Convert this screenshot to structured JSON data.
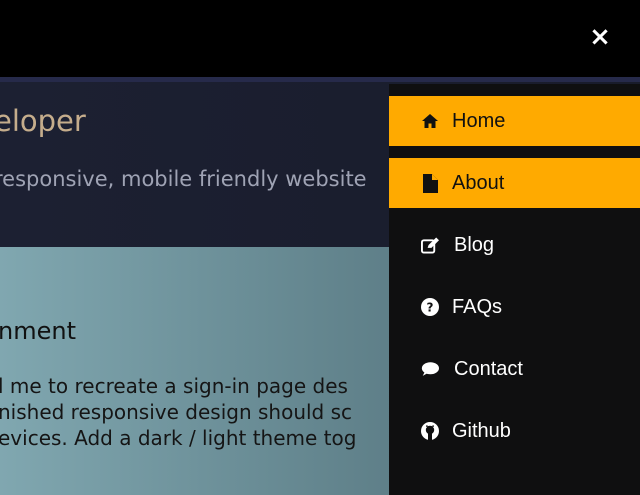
{
  "header": {
    "close_label": "×"
  },
  "hero": {
    "title": "eloper",
    "subtitle": "responsive, mobile friendly website"
  },
  "content": {
    "title": "nment",
    "lines": [
      "l me to recreate a sign-in page des",
      "nished responsive design should sc",
      "evices. Add a dark / light theme tog"
    ]
  },
  "menu": {
    "items": [
      {
        "label": "Home",
        "icon": "home-icon",
        "active": true
      },
      {
        "label": "About",
        "icon": "file-icon",
        "active": true
      },
      {
        "label": "Blog",
        "icon": "edit-icon",
        "active": false
      },
      {
        "label": "FAQs",
        "icon": "question-icon",
        "active": false
      },
      {
        "label": "Contact",
        "icon": "chat-icon",
        "active": false
      },
      {
        "label": "Github",
        "icon": "github-icon",
        "active": false
      }
    ]
  },
  "colors": {
    "accent": "#ffaa00",
    "menu_bg": "#0f0f10",
    "hero_bg": "#1c2032"
  }
}
